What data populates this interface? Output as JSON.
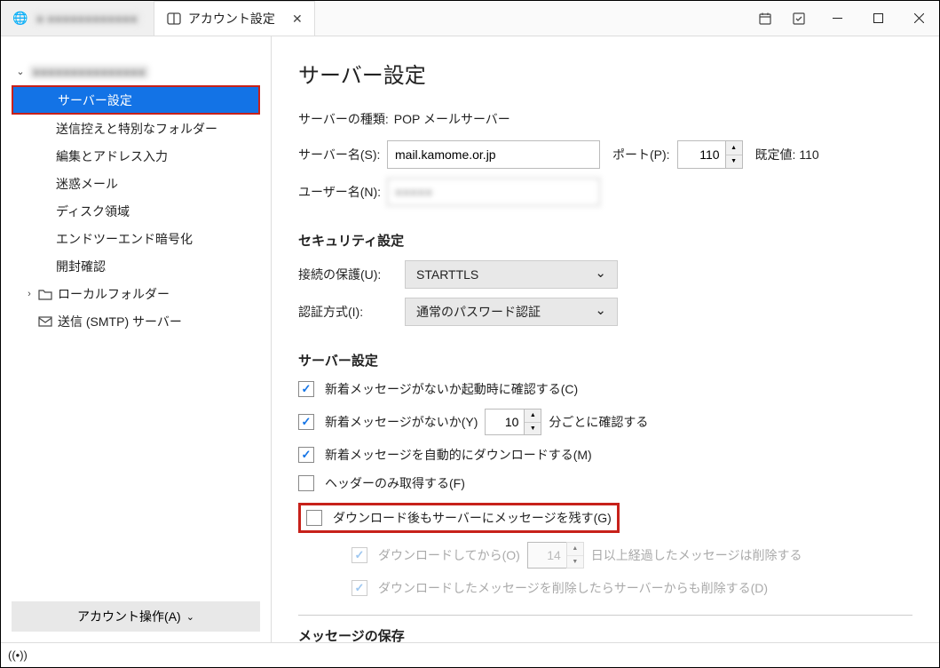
{
  "tabs": {
    "inactive_label": "■ ■■■■■■■■■■■■",
    "active_label": "アカウント設定"
  },
  "sidebar": {
    "account_name": "■■■■■■■■■■■■■■■",
    "items": [
      "サーバー設定",
      "送信控えと特別なフォルダー",
      "編集とアドレス入力",
      "迷惑メール",
      "ディスク領域",
      "エンドツーエンド暗号化",
      "開封確認"
    ],
    "local_folders": "ローカルフォルダー",
    "smtp": "送信 (SMTP) サーバー",
    "account_actions": "アカウント操作(A)"
  },
  "content": {
    "title": "サーバー設定",
    "server_type_label": "サーバーの種類:",
    "server_type_value": "POP メールサーバー",
    "server_name_label": "サーバー名(S):",
    "server_name_value": "mail.kamome.or.jp",
    "port_label": "ポート(P):",
    "port_value": "110",
    "default_label": "既定値:",
    "default_value": "110",
    "username_label": "ユーザー名(N):",
    "username_value": "■■■■■",
    "security_title": "セキュリティ設定",
    "connection_security_label": "接続の保護(U):",
    "connection_security_value": "STARTTLS",
    "auth_method_label": "認証方式(I):",
    "auth_method_value": "通常のパスワード認証",
    "server_settings_title": "サーバー設定",
    "check_startup": "新着メッセージがないか起動時に確認する(C)",
    "check_every_pre": "新着メッセージがないか(Y)",
    "check_every_value": "10",
    "check_every_post": "分ごとに確認する",
    "auto_download": "新着メッセージを自動的にダウンロードする(M)",
    "headers_only": "ヘッダーのみ取得する(F)",
    "leave_on_server": "ダウンロード後もサーバーにメッセージを残す(G)",
    "delete_after_pre": "ダウンロードしてから(O)",
    "delete_after_value": "14",
    "delete_after_post": "日以上経過したメッセージは削除する",
    "delete_from_server": "ダウンロードしたメッセージを削除したらサーバーからも削除する(D)",
    "storage_title": "メッセージの保存"
  }
}
